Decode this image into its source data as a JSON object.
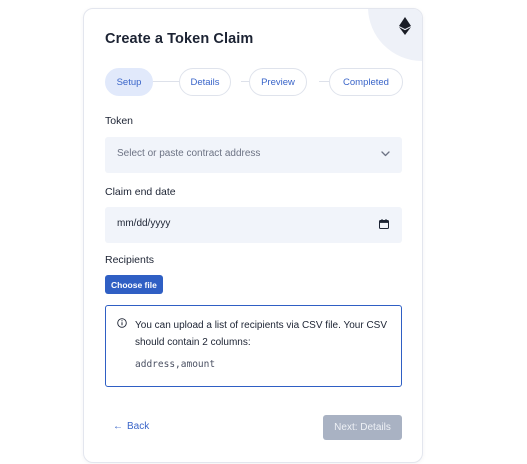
{
  "header": {
    "title": "Create a Token Claim",
    "corner_icon": "ethereum-icon"
  },
  "stepper": {
    "steps": [
      {
        "label": "Setup",
        "active": true
      },
      {
        "label": "Details",
        "active": false
      },
      {
        "label": "Preview",
        "active": false
      },
      {
        "label": "Completed",
        "active": false
      }
    ]
  },
  "form": {
    "token": {
      "label": "Token",
      "placeholder": "Select or paste contract address",
      "icon": "chevron-down-icon"
    },
    "claim_end_date": {
      "label": "Claim end date",
      "value": "mm/dd/yyyy",
      "icon": "calendar-icon"
    },
    "recipients": {
      "label": "Recipients",
      "button_label": "Choose file"
    }
  },
  "info": {
    "icon": "info-icon",
    "text": "You can upload a list of recipients via CSV file. Your CSV should contain 2 columns:",
    "code": "address,amount"
  },
  "footer": {
    "back_label": "Back",
    "next_label": "Next: Details"
  },
  "colors": {
    "accent": "#2f5fc4",
    "disabled": "#a9b2c3",
    "field_bg": "#f1f4fa"
  }
}
